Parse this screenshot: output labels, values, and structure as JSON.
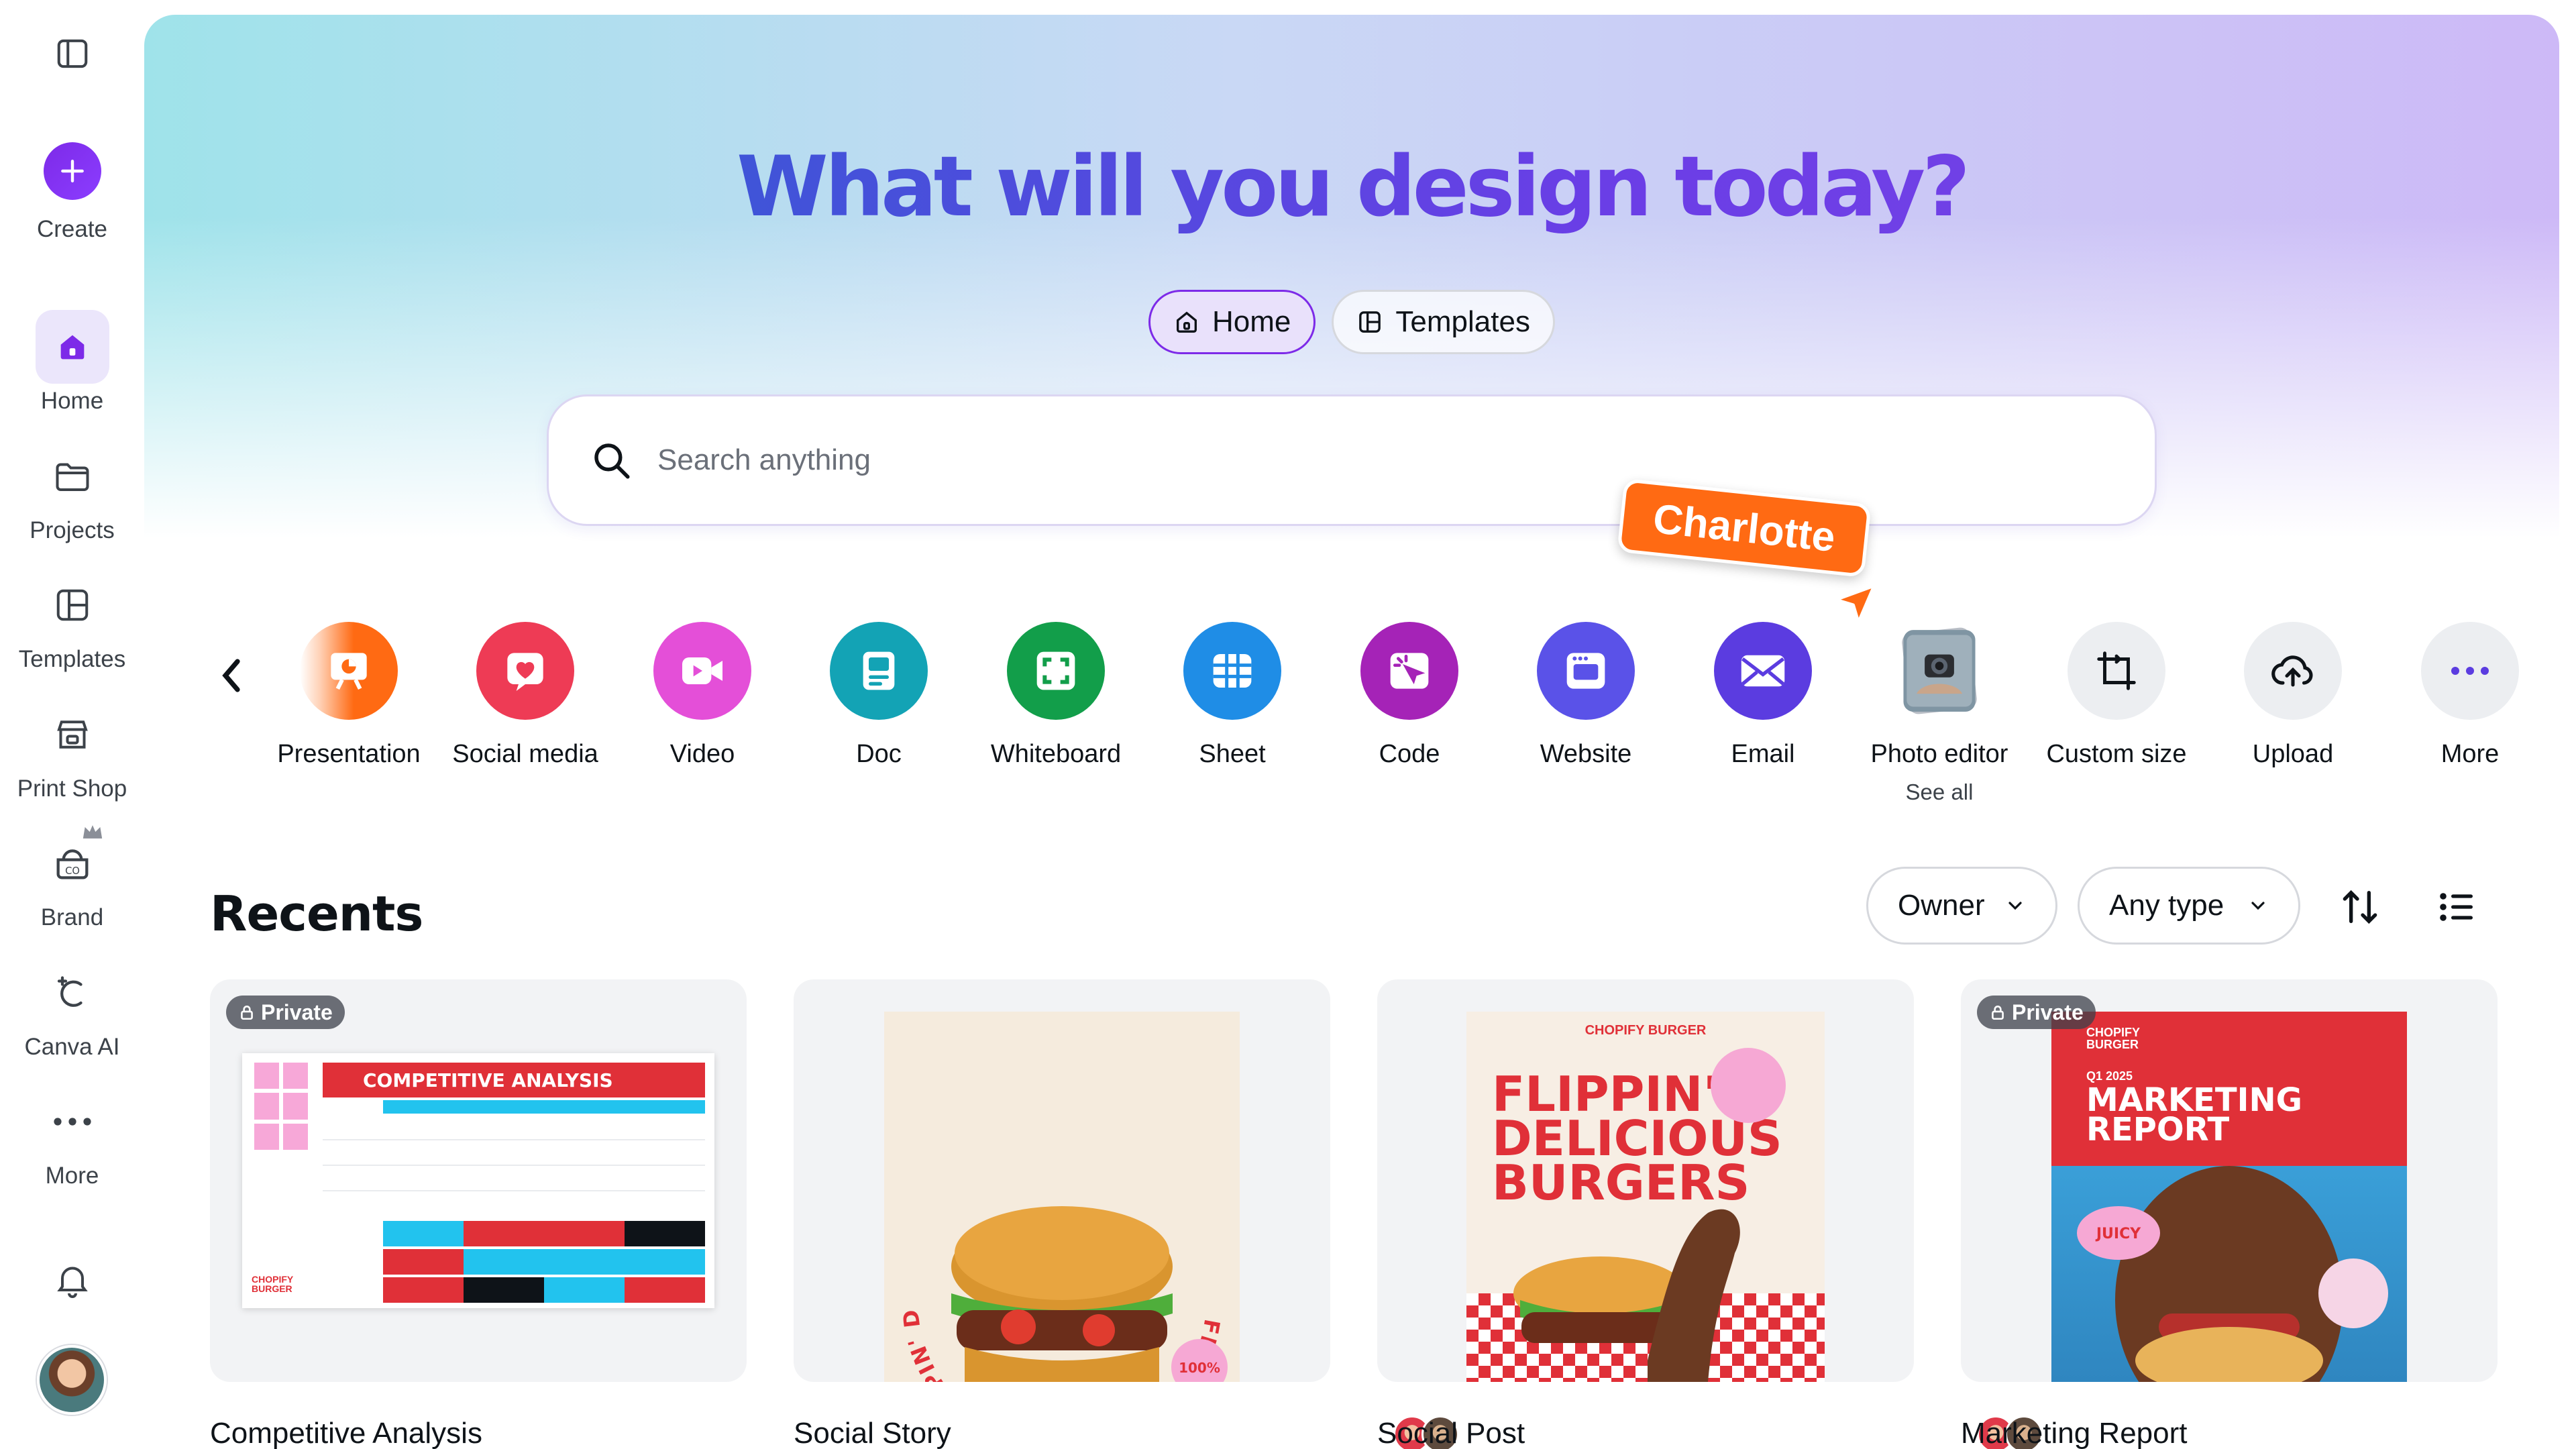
{
  "sidebar": {
    "create_label": "Create",
    "items": [
      {
        "label": "Home",
        "icon": "home-icon",
        "active": true
      },
      {
        "label": "Projects",
        "icon": "folder-icon"
      },
      {
        "label": "Templates",
        "icon": "templates-icon"
      },
      {
        "label": "Print Shop",
        "icon": "store-icon"
      },
      {
        "label": "Brand",
        "icon": "brand-icon"
      },
      {
        "label": "Canva AI",
        "icon": "canva-ai-icon"
      },
      {
        "label": "More",
        "icon": "more-dots-icon"
      }
    ]
  },
  "hero": {
    "title": "What will you design today?",
    "tabs": [
      {
        "label": "Home",
        "active": true
      },
      {
        "label": "Templates"
      }
    ],
    "search_placeholder": "Search anything"
  },
  "collaborator_cursor": {
    "name": "Charlotte",
    "color": "#ff6a13"
  },
  "quick_actions": [
    {
      "label": "Presentation",
      "color": "#ff6a13"
    },
    {
      "label": "Social media",
      "color": "#ee3b55"
    },
    {
      "label": "Video",
      "color": "#e44fd8"
    },
    {
      "label": "Doc",
      "color": "#13a3b5"
    },
    {
      "label": "Whiteboard",
      "color": "#129e4a"
    },
    {
      "label": "Sheet",
      "color": "#1f8de6"
    },
    {
      "label": "Code",
      "color": "#a523b7"
    },
    {
      "label": "Website",
      "color": "#5a52e8"
    },
    {
      "label": "Email",
      "color": "#5b3ce0"
    },
    {
      "label": "Photo editor",
      "sub": "See all"
    },
    {
      "label": "Custom size"
    },
    {
      "label": "Upload"
    },
    {
      "label": "More"
    }
  ],
  "recents": {
    "title": "Recents",
    "filters": {
      "owner": "Owner",
      "type": "Any type"
    },
    "cards": [
      {
        "title": "Competitive Analysis",
        "badge": "Private",
        "thumb_heading": "COMPETITIVE ANALYSIS",
        "brand": "CHOPIFY BURGER"
      },
      {
        "title": "Social Story",
        "thumb_text": "FLIPPIN' DELICIOUS · FLIPPIN' DELICIOUS ·",
        "sticker": "100%"
      },
      {
        "title": "Social Post",
        "brand": "CHOPIFY BURGER",
        "thumb_heading": "FLIPPIN' DELICIOUS BURGERS"
      },
      {
        "title": "Marketing Report",
        "badge": "Private",
        "brand": "CHOPIFY BURGER",
        "date": "Q1 2025",
        "thumb_heading": "MARKETING REPORT",
        "sticker": "JUICY"
      }
    ]
  }
}
